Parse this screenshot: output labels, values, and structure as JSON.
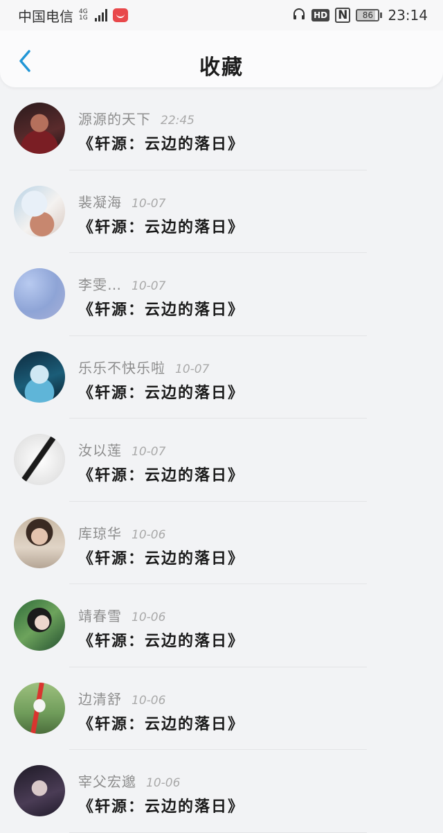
{
  "status_bar": {
    "carrier": "中国电信",
    "network": "4G",
    "network_sub": "1G",
    "hd": "HD",
    "nfc": "N",
    "battery": "86",
    "time": "23:14"
  },
  "header": {
    "title": "收藏",
    "accent_color": "#2196d6"
  },
  "items": [
    {
      "name": "源源的天下",
      "time": "22:45",
      "title": "《轩源：云边的落日》"
    },
    {
      "name": "裴凝海",
      "time": "10-07",
      "title": "《轩源：云边的落日》"
    },
    {
      "name": "李雯…",
      "time": "10-07",
      "title": "《轩源：云边的落日》"
    },
    {
      "name": "乐乐不快乐啦",
      "time": "10-07",
      "title": "《轩源：云边的落日》"
    },
    {
      "name": "汝以莲",
      "time": "10-07",
      "title": "《轩源：云边的落日》"
    },
    {
      "name": "库琼华",
      "time": "10-06",
      "title": "《轩源：云边的落日》"
    },
    {
      "name": "靖春雪",
      "time": "10-06",
      "title": "《轩源：云边的落日》"
    },
    {
      "name": "边清舒",
      "time": "10-06",
      "title": "《轩源：云边的落日》"
    },
    {
      "name": "宰父宏邈",
      "time": "10-06",
      "title": "《轩源：云边的落日》"
    }
  ]
}
